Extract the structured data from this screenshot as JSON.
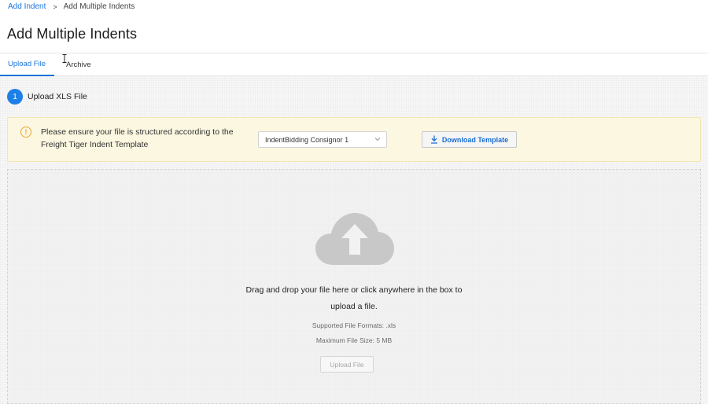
{
  "breadcrumb": {
    "parent": "Add Indent",
    "separator": ">",
    "current": "Add Multiple Indents"
  },
  "page": {
    "title": "Add Multiple Indents"
  },
  "tabs": [
    {
      "label": "Upload File",
      "active": true
    },
    {
      "label": "Archive",
      "active": false
    }
  ],
  "step": {
    "number": "1",
    "title": "Upload XLS File"
  },
  "banner": {
    "icon": "warning-icon",
    "message": "Please ensure your file is structured according to the Freight Tiger Indent Template",
    "template_select": {
      "value": "IndentBidding Consignor 1"
    },
    "download_label": "Download Template"
  },
  "dropzone": {
    "icon": "cloud-upload-icon",
    "instruction": "Drag and drop your file here or click anywhere in the box to upload a file.",
    "formats": "Supported File Formats: .xls",
    "max_size": "Maximum File Size: 5 MB",
    "upload_label": "Upload File"
  },
  "colors": {
    "accent": "#1a73d9",
    "warning": "#e9a73a",
    "banner_bg": "#fbf7e0"
  }
}
